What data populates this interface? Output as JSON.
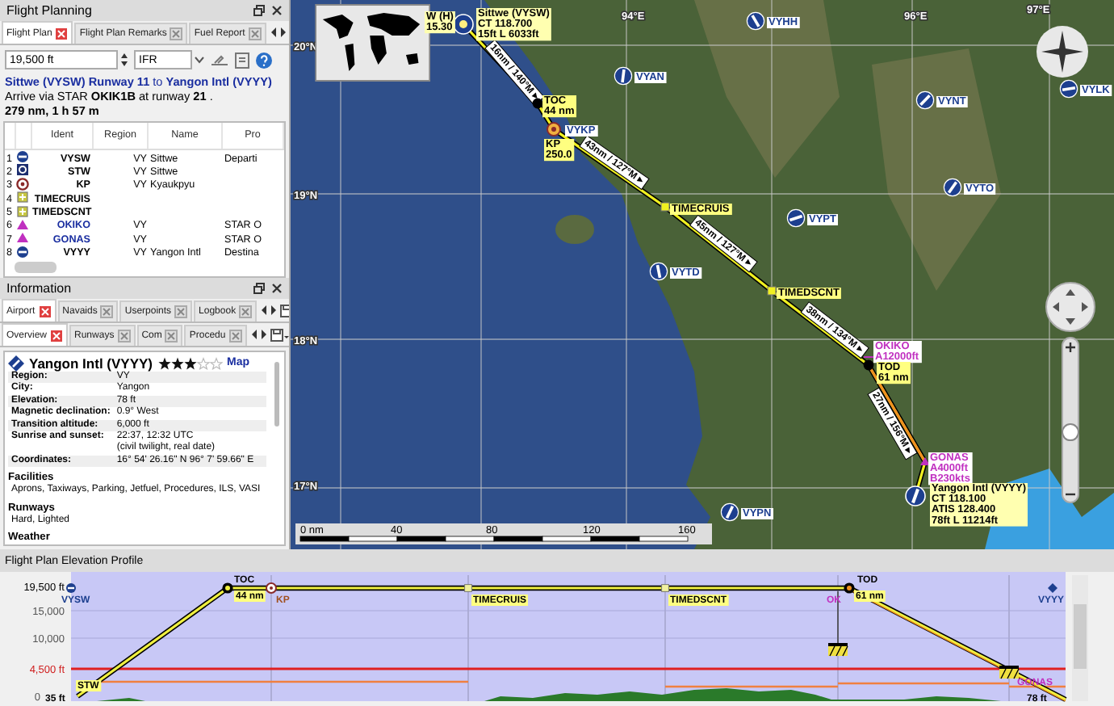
{
  "flight_planning": {
    "title": "Flight Planning",
    "tabs": [
      {
        "label": "Flight Plan",
        "selected": true
      },
      {
        "label": "Flight Plan Remarks",
        "selected": false
      },
      {
        "label": "Fuel Report",
        "selected": false
      }
    ],
    "altitude": "19,500 ft",
    "rules": "IFR",
    "summary": [
      "**Sittwe (VYSW)** **Runway 11** to **Yangon Intl (VYYY)**",
      "Arrive via STAR **OKIK1B** at runway **21** ."
    ],
    "distance_time": "279 nm, 1 h 57 m",
    "table": {
      "columns": [
        "Ident",
        "Region",
        "Name",
        "Pro"
      ],
      "rows": [
        {
          "number": "1",
          "kind": "airport",
          "ident": "VYSW",
          "region": "VY",
          "name": "Sittwe",
          "procedure": "Departi"
        },
        {
          "number": "2",
          "kind": "vor",
          "ident": "STW",
          "region": "VY",
          "name": "Sittwe"
        },
        {
          "number": "3",
          "kind": "ndb",
          "ident": "KP",
          "region": "VY",
          "name": "Kyaukpyu"
        },
        {
          "number": "4",
          "kind": "userpoint",
          "ident": "TIMECRUIS"
        },
        {
          "number": "5",
          "kind": "userpoint",
          "ident": "TIMEDSCNT"
        },
        {
          "number": "6",
          "kind": "procedure",
          "ident": "OKIKO",
          "region": "VY",
          "procedure": "STAR O"
        },
        {
          "number": "7",
          "kind": "procedure",
          "ident": "GONAS",
          "region": "VY",
          "procedure": "STAR O"
        },
        {
          "number": "8",
          "kind": "airport",
          "ident": "VYYY",
          "region": "VY",
          "name": "Yangon Intl",
          "procedure": "Destina"
        }
      ]
    }
  },
  "information": {
    "title": "Information",
    "tabs": [
      {
        "label": "Airport",
        "selected": true
      },
      {
        "label": "Navaids",
        "selected": false
      },
      {
        "label": "Userpoints",
        "selected": false
      },
      {
        "label": "Logbook",
        "selected": false
      }
    ],
    "subtabs": [
      {
        "label": "Overview",
        "selected": true
      },
      {
        "label": "Runways",
        "selected": false
      },
      {
        "label": "Com",
        "selected": false
      },
      {
        "label": "Procedu",
        "selected": false
      }
    ],
    "airport": {
      "name": "Yangon Intl (VYYY)",
      "stars": 3,
      "map_link": "Map"
    },
    "details": [
      {
        "label": "Region:",
        "value": "VY"
      },
      {
        "label": "City:",
        "value": "Yangon"
      },
      {
        "label": "Elevation:",
        "value": "78 ft"
      },
      {
        "label": "Magnetic declination:",
        "value": "0.9° West"
      },
      {
        "label": "Transition altitude:",
        "value": "6,000 ft"
      },
      {
        "label": "Sunrise and sunset:",
        "value": "22:37, 12:32 UTC",
        "note": "(civil twilight, real date)"
      },
      {
        "label": "Coordinates:",
        "value": "16° 54' 26.16\" N 96° 7' 59.66\" E"
      }
    ],
    "sections": [
      {
        "heading": "Facilities",
        "text": "Aprons, Taxiways, Parking, Jetfuel, Procedures, ILS, VASI"
      },
      {
        "heading": "Runways",
        "text": "Hard, Lighted"
      },
      {
        "heading": "Weather"
      }
    ]
  },
  "map": {
    "grid_labels": [
      "94°E",
      "96°E",
      "97°E",
      "20°N",
      "19°N",
      "18°N",
      "17°N"
    ],
    "airports": [
      "VYHH",
      "VYAN",
      "VYNT",
      "VYLK",
      "VYKP",
      "VYTO",
      "VYPT",
      "VYTD",
      "VYPN"
    ],
    "route_labels": [
      {
        "kind": "airport",
        "lines": [
          "W (H)",
          "15.30"
        ]
      },
      {
        "kind": "airport",
        "lines": [
          "Sittwe (VYSW)",
          "CT 118.700",
          "15ft L 6033ft"
        ]
      },
      {
        "kind": "waypoint",
        "lines": [
          "TOC",
          "44 nm"
        ]
      },
      {
        "kind": "waypoint",
        "lines": [
          "KP",
          "250.0"
        ]
      },
      {
        "kind": "waypoint",
        "lines": [
          "TIMECRUIS"
        ]
      },
      {
        "kind": "waypoint",
        "lines": [
          "TIMEDSCNT"
        ]
      },
      {
        "kind": "procedure",
        "lines": [
          "OKIKO",
          "A12000ft"
        ]
      },
      {
        "kind": "waypoint",
        "lines": [
          "TOD",
          "61 nm"
        ]
      },
      {
        "kind": "procedure",
        "lines": [
          "GONAS",
          "A4000ft",
          "B230kts"
        ]
      },
      {
        "kind": "airport",
        "lines": [
          "Yangon Intl (VYYY)",
          "CT 118.100",
          "ATIS 128.400",
          "78ft L 11214ft"
        ]
      }
    ],
    "leg_labels": [
      "16nm / 140°M ▸",
      "43nm / 127°M ▸",
      "45nm / 127°M ▸",
      "38nm / 134°M ▸",
      "27nm / 156°M ▸"
    ],
    "scale": [
      "0 nm",
      "40",
      "80",
      "120",
      "160"
    ],
    "zoom": {
      "level": 0.42
    }
  },
  "profile": {
    "title": "Flight Plan Elevation Profile",
    "y_labels": [
      {
        "text": "19,500 ft",
        "kind": "cruise"
      },
      {
        "text": "15,000",
        "kind": "tick"
      },
      {
        "text": "10,000",
        "kind": "tick"
      },
      {
        "text": "4,500 ft",
        "kind": "safe"
      },
      {
        "text": "0",
        "kind": "tick"
      }
    ],
    "labels": [
      {
        "text": "VYSW",
        "kind": "airport"
      },
      {
        "text": "TOC",
        "kind": "point"
      },
      {
        "text": "44 nm",
        "kind": "waypoint"
      },
      {
        "text": "KP",
        "kind": "ndb"
      },
      {
        "text": "TIMECRUIS",
        "kind": "waypoint"
      },
      {
        "text": "TIMEDSCNT",
        "kind": "waypoint"
      },
      {
        "text": "OK",
        "kind": "procedure"
      },
      {
        "text": "TOD",
        "kind": "point"
      },
      {
        "text": "61 nm",
        "kind": "waypoint"
      },
      {
        "text": "GONAS",
        "kind": "procedure"
      },
      {
        "text": "VYYY",
        "kind": "airport"
      },
      {
        "text": "STW",
        "kind": "waypoint"
      },
      {
        "text": "35 ft",
        "kind": "point"
      },
      {
        "text": "78 ft",
        "kind": "point"
      }
    ]
  }
}
